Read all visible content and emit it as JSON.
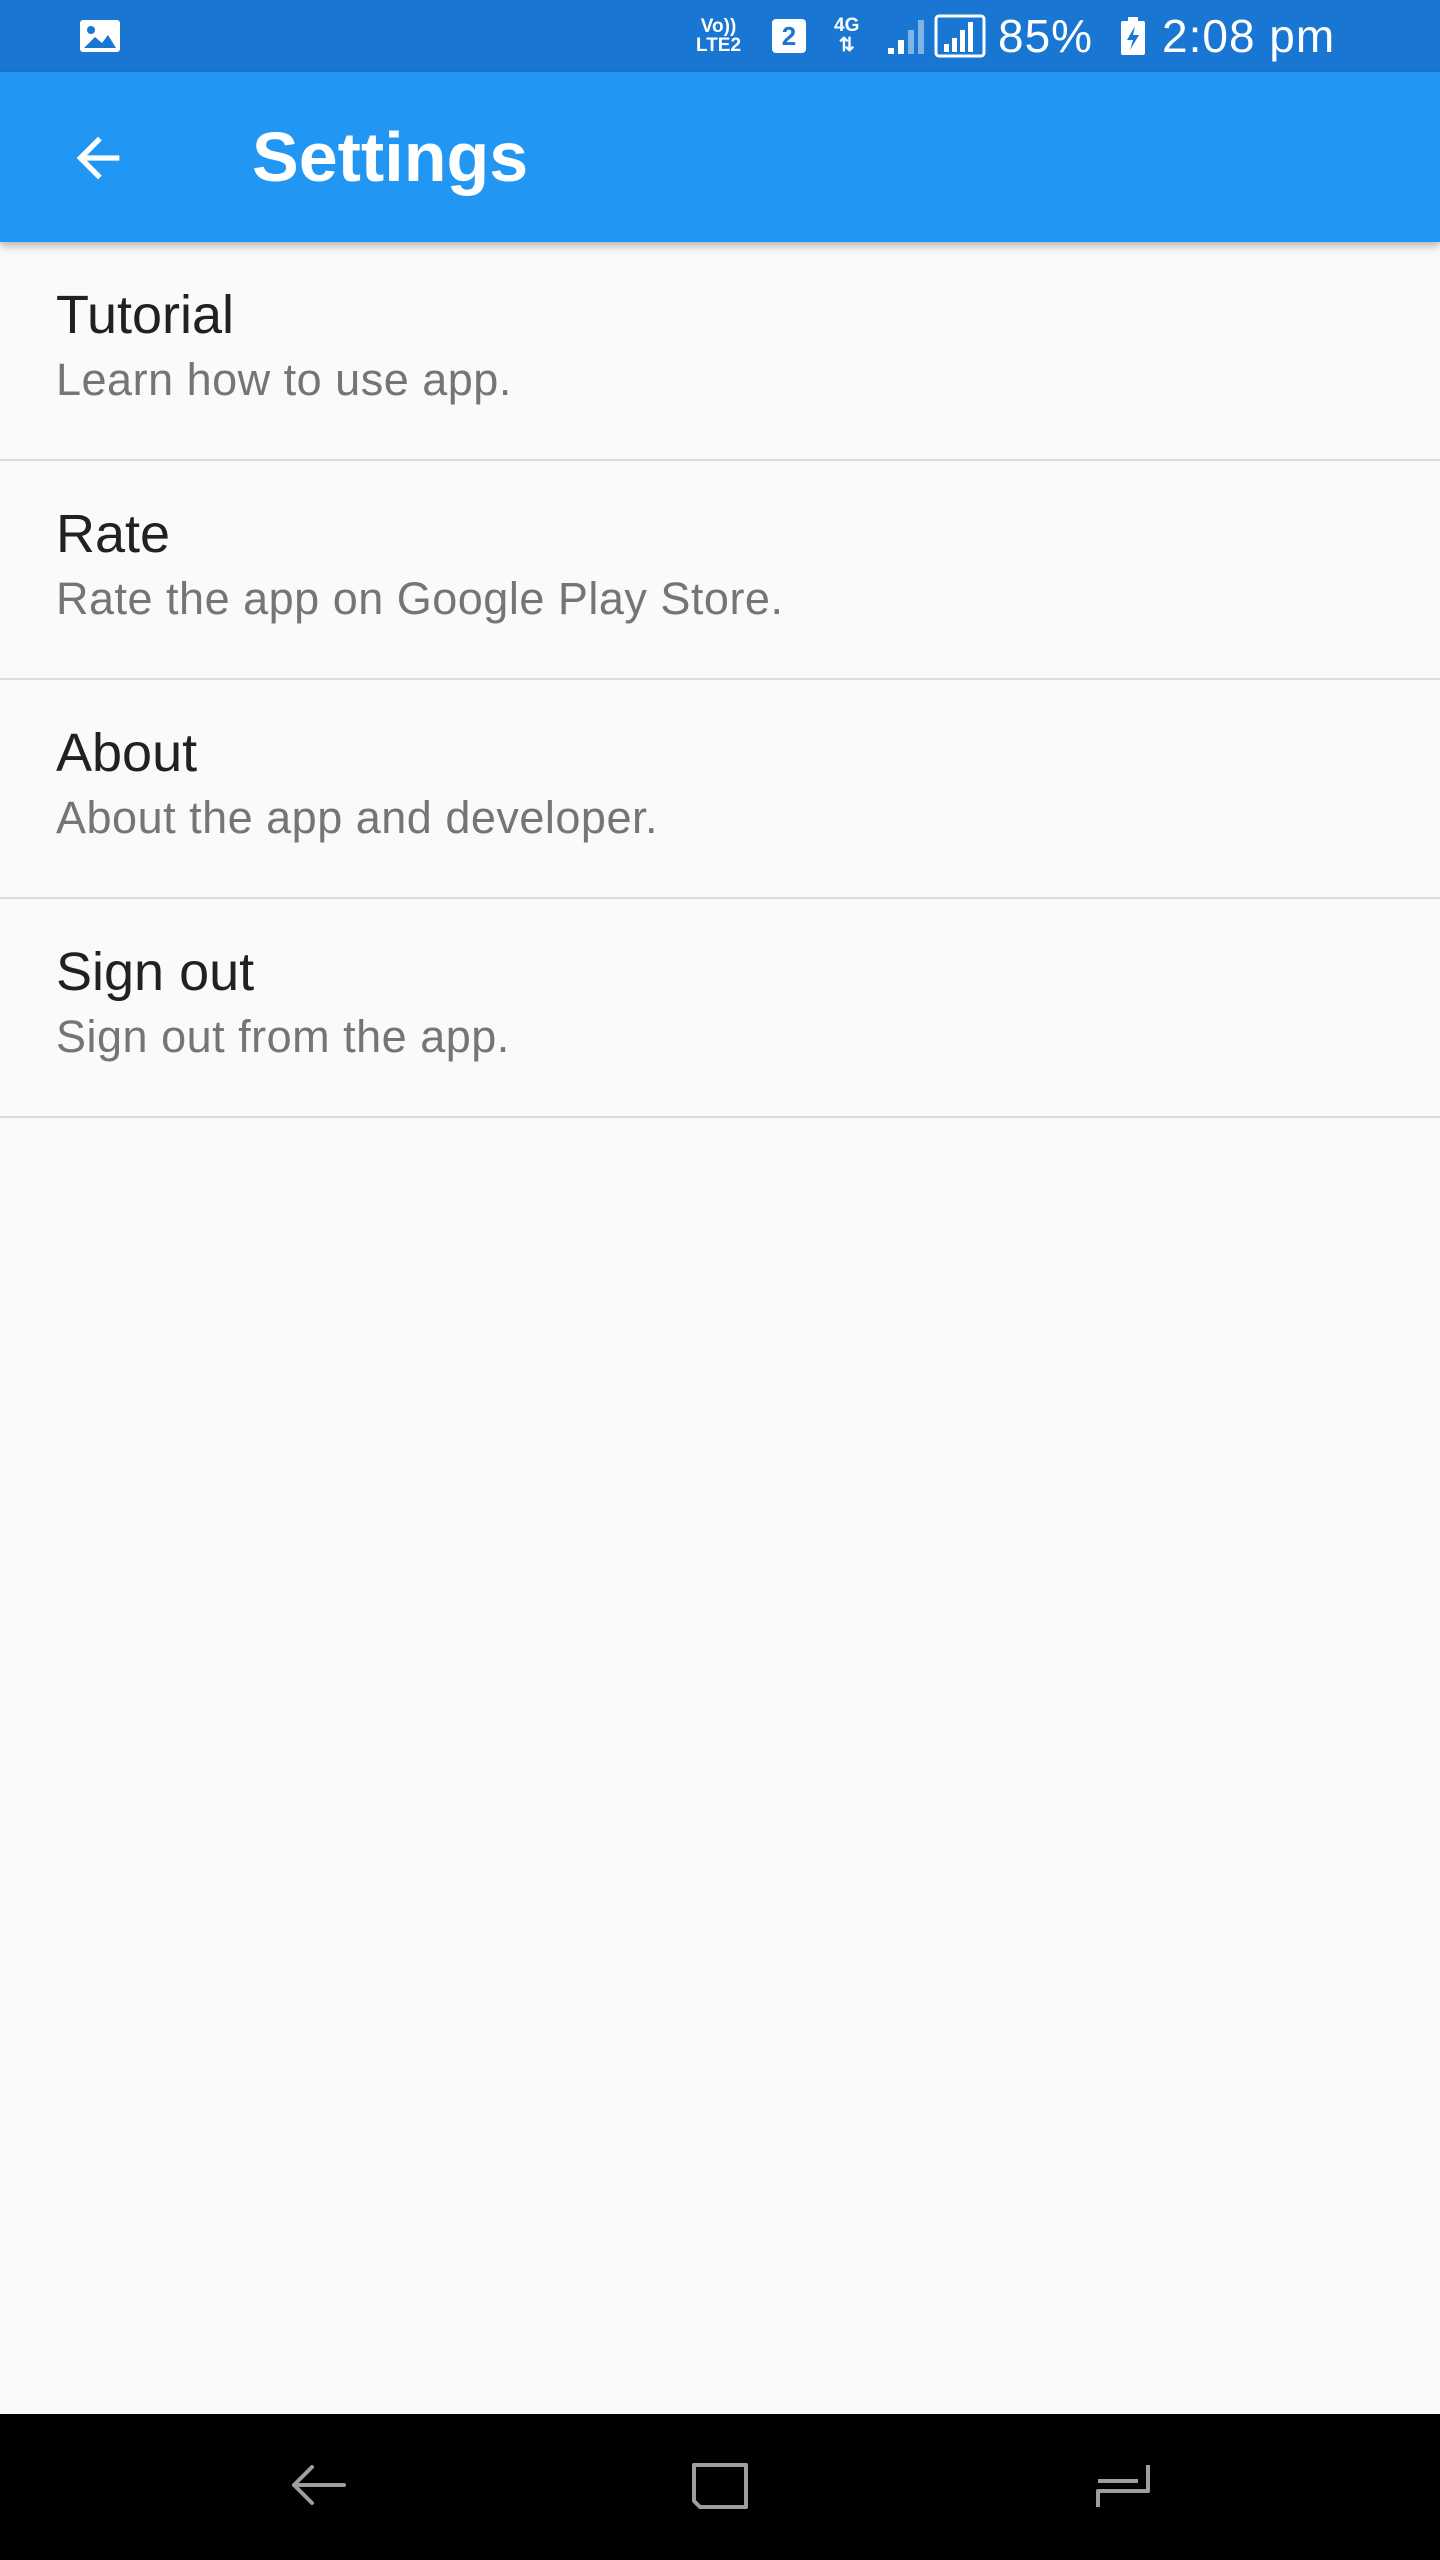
{
  "status_bar": {
    "volte_top": "Vo))",
    "volte_bottom": "LTE2",
    "sim_slot": "2",
    "network_type": "4G",
    "network_arrows": "⇅",
    "battery_percent": "85%",
    "time": "2:08 pm",
    "icons": [
      "gallery-icon",
      "sim-icon",
      "signal-icon",
      "battery-charging-icon"
    ]
  },
  "app_bar": {
    "title": "Settings",
    "back_icon": "arrow-back-icon"
  },
  "settings": {
    "items": [
      {
        "title": "Tutorial",
        "subtitle": "Learn how to use app."
      },
      {
        "title": "Rate",
        "subtitle": "Rate the app on Google Play Store."
      },
      {
        "title": "About",
        "subtitle": "About the app and developer."
      },
      {
        "title": "Sign out",
        "subtitle": "Sign out from the app."
      }
    ]
  },
  "nav_bar": {
    "icons": [
      "nav-back-icon",
      "nav-home-icon",
      "nav-recents-icon"
    ]
  },
  "colors": {
    "status_bar": "#1976d2",
    "app_bar": "#2196f3",
    "background": "#fafafa",
    "title_text": "#212121",
    "subtitle_text": "#757575",
    "divider": "#dcdcdc",
    "nav_bar": "#000000"
  }
}
